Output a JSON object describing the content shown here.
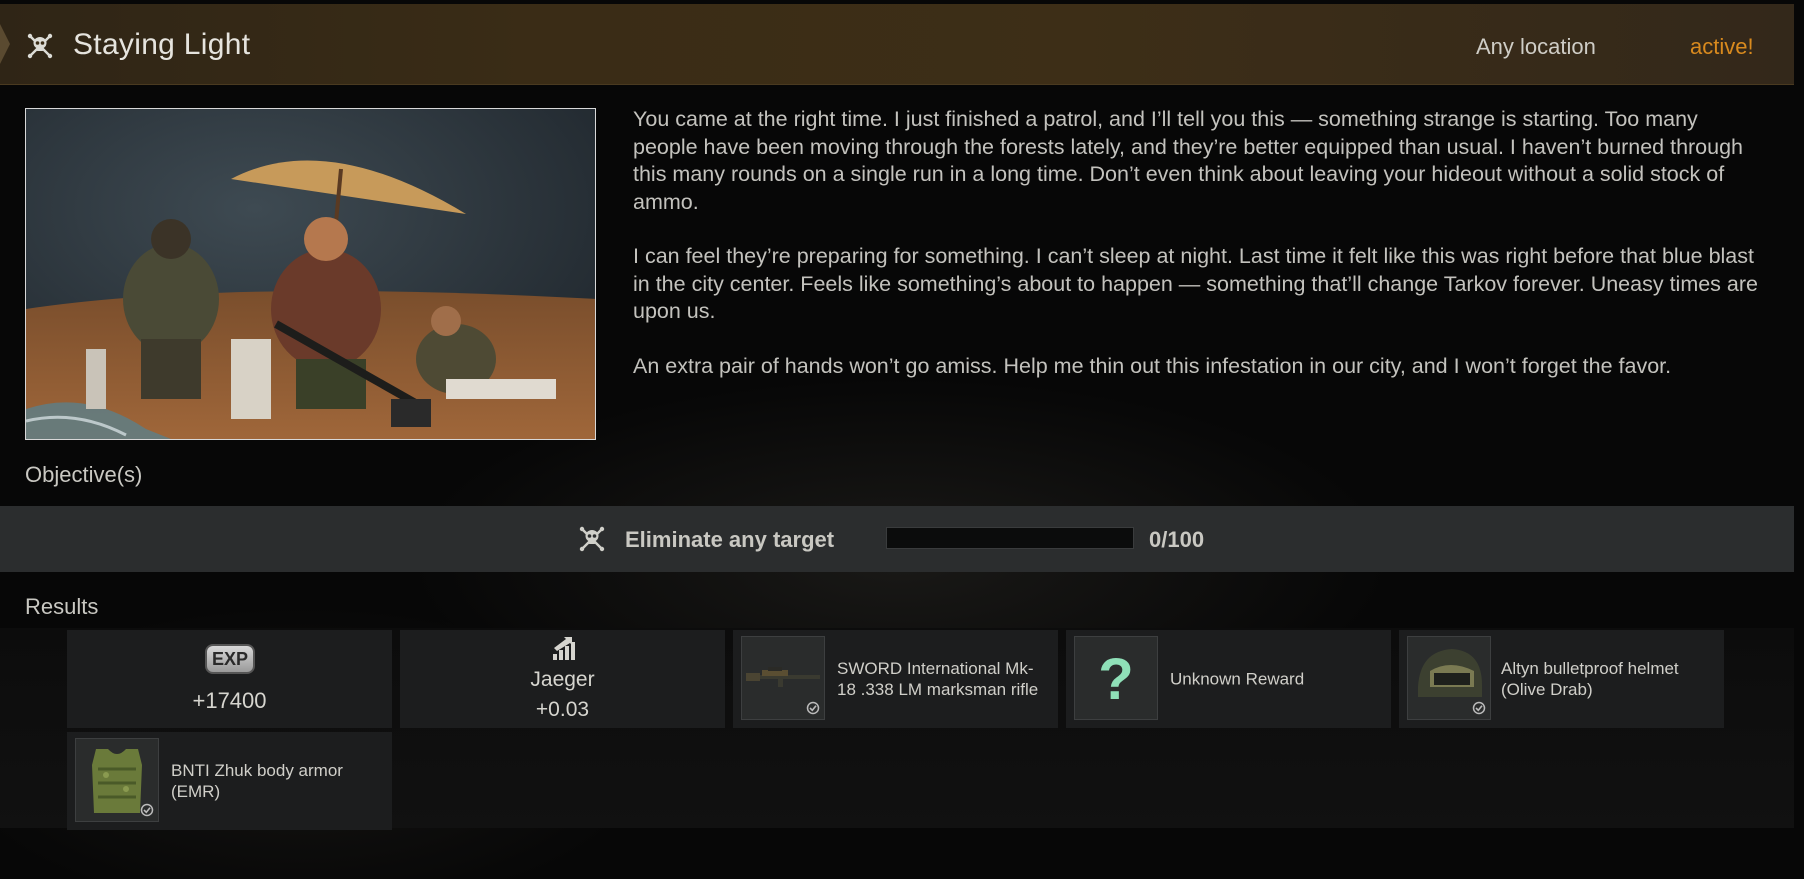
{
  "quest": {
    "title": "Staying Light",
    "location": "Any location",
    "status": "active!",
    "status_color": "#d98a1e",
    "icon": "skull-crossbones-icon"
  },
  "description": [
    "You came at the right time. I just finished a patrol, and I’ll tell you this — something strange is starting. Too many people have been moving through the forests lately, and they’re better equipped than usual. I haven’t burned through this many rounds on a single run in a long time. Don’t even think about leaving your hideout without a solid stock of ammo.",
    "I can feel they’re preparing for something. I can’t sleep at night. Last time it felt like this was right before that blue blast in the city center. Feels like something’s about to happen — something that’ll change Tarkov forever. Uneasy times are upon us.",
    "An extra pair of hands won’t go amiss. Help me thin out this infestation in our city, and I won’t forget the favor."
  ],
  "objectives_label": "Objective(s)",
  "objective": {
    "icon": "skull-crossbones-icon",
    "label": "Eliminate any target",
    "progress": 0,
    "count": "0/100"
  },
  "results_label": "Results",
  "rewards": {
    "exp": {
      "badge": "EXP",
      "value": "+17400"
    },
    "reputation": {
      "icon": "reputation-up-icon",
      "trader": "Jaeger",
      "value": "+0.03"
    },
    "items": [
      {
        "name": "SWORD International Mk-18 .338 LM marksman rifle",
        "icon": "rifle-icon"
      },
      {
        "name": "Unknown Reward",
        "icon": "question-mark-icon"
      },
      {
        "name": "Altyn bulletproof helmet (Olive Drab)",
        "icon": "helmet-icon"
      },
      {
        "name": "BNTI Zhuk body armor (EMR)",
        "icon": "body-armor-icon"
      }
    ]
  }
}
